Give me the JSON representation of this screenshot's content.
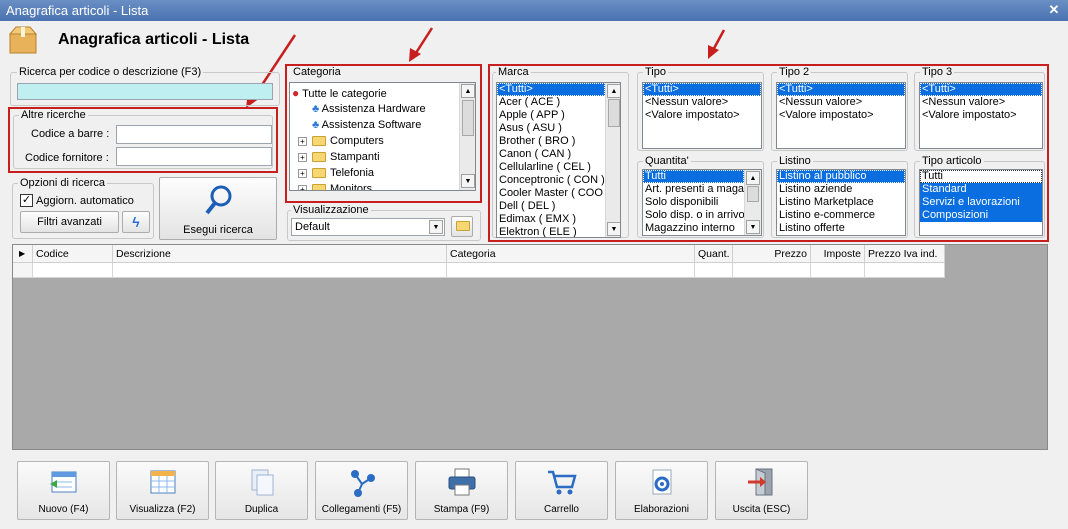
{
  "window": {
    "title": "Anagrafica articoli  - Lista",
    "close_glyph": "✕"
  },
  "header": {
    "title": "Anagrafica articoli  - Lista"
  },
  "search": {
    "label": "Ricerca per codice o descrizione (F3)",
    "value": ""
  },
  "altre": {
    "label": "Altre ricerche",
    "barcode_label": "Codice a barre :",
    "barcode_value": "",
    "supplier_label": "Codice fornitore :",
    "supplier_value": ""
  },
  "options": {
    "label": "Opzioni di ricerca",
    "auto_update_label": "Aggiorn. automatico",
    "auto_update_checked": true,
    "filters_button": "Filtri avanzati",
    "search_button": "Esegui ricerca"
  },
  "categoria": {
    "label": "Categoria",
    "items": [
      "Tutte le categorie",
      "Assistenza Hardware",
      "Assistenza Software",
      "Computers",
      "Stampanti",
      "Telefonia",
      "Monitors"
    ]
  },
  "visualizzazione": {
    "label": "Visualizzazione",
    "value": "Default"
  },
  "marca": {
    "label": "Marca",
    "items": [
      "<Tutti>",
      "Acer ( ACE )",
      "Apple ( APP )",
      "Asus ( ASU )",
      "Brother ( BRO )",
      "Canon ( CAN )",
      "Cellularline ( CEL )",
      "Conceptronic ( CON )",
      "Cooler Master ( COO )",
      "Dell ( DEL )",
      "Edimax ( EMX )",
      "Elektron ( ELE )"
    ]
  },
  "tipo": {
    "label": "Tipo",
    "items": [
      "<Tutti>",
      "<Nessun valore>",
      "<Valore impostato>"
    ]
  },
  "tipo2": {
    "label": "Tipo 2",
    "items": [
      "<Tutti>",
      "<Nessun valore>",
      "<Valore impostato>"
    ]
  },
  "tipo3": {
    "label": "Tipo 3",
    "items": [
      "<Tutti>",
      "<Nessun valore>",
      "<Valore impostato>"
    ]
  },
  "quantita": {
    "label": "Quantita'",
    "items": [
      "Tutti",
      "Art. presenti a magazzino",
      "Solo disponibili",
      "Solo disp. o in arrivo",
      "Magazzino interno"
    ]
  },
  "listino": {
    "label": "Listino",
    "items": [
      "Listino al pubblico",
      "Listino aziende",
      "Listino Marketplace",
      "Listino e-commerce",
      "Listino offerte"
    ]
  },
  "tipo_articolo": {
    "label": "Tipo articolo",
    "items": [
      "Tutti",
      "Standard",
      "Servizi e lavorazioni",
      "Composizioni"
    ]
  },
  "table": {
    "columns": [
      "Codice",
      "Descrizione",
      "Categoria",
      "Quant.",
      "Prezzo",
      "Imposte",
      "Prezzo Iva ind."
    ]
  },
  "toolbar": {
    "nuovo": "Nuovo (F4)",
    "visualizza": "Visualizza (F2)",
    "duplica": "Duplica",
    "collegamenti": "Collegamenti (F5)",
    "stampa": "Stampa (F9)",
    "carrello": "Carrello",
    "elaborazioni": "Elaborazioni",
    "uscita": "Uscita (ESC)"
  },
  "colors": {
    "accent": "#c81e1e",
    "selection": "#0a6ee0",
    "search_bg": "#bfeff0"
  }
}
